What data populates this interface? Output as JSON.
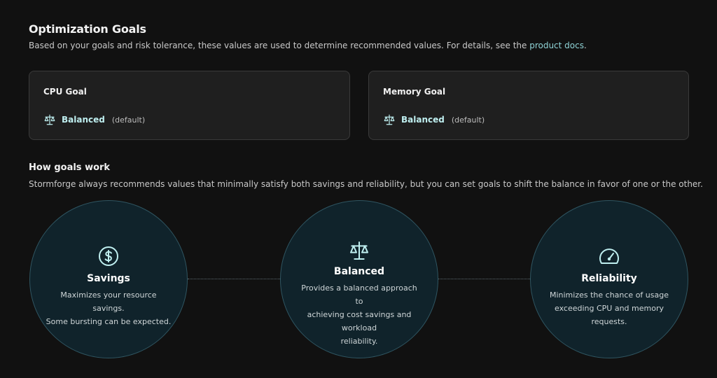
{
  "header": {
    "title": "Optimization Goals",
    "subtitle_prefix": "Based on your goals and risk tolerance, these values are used to determine recommended values. For details, see the ",
    "subtitle_link": "product docs",
    "subtitle_suffix": "."
  },
  "cards": {
    "cpu": {
      "title": "CPU Goal",
      "value": "Balanced",
      "note": "(default)",
      "icon": "scale-icon"
    },
    "memory": {
      "title": "Memory Goal",
      "value": "Balanced",
      "note": "(default)",
      "icon": "scale-icon"
    }
  },
  "how": {
    "title": "How goals work",
    "description": "Stormforge always recommends values that minimally satisfy both savings and reliability, but you can set goals to shift the balance in favor of one or the other."
  },
  "modes": {
    "savings": {
      "title": "Savings",
      "icon": "dollar-circle-icon",
      "desc1": "Maximizes your resource savings.",
      "desc2": "Some bursting can be expected."
    },
    "balanced": {
      "title": "Balanced",
      "icon": "scale-icon",
      "desc1": "Provides a balanced approach to",
      "desc2": "achieving cost savings and workload",
      "desc3": "reliability."
    },
    "reliability": {
      "title": "Reliability",
      "icon": "gauge-icon",
      "desc1": "Minimizes the chance of usage",
      "desc2": "exceeding CPU and memory requests."
    }
  },
  "colors": {
    "accent": "#8fd3d6",
    "background": "#111111",
    "card": "#1f1f1f",
    "circle": "#10232b"
  }
}
